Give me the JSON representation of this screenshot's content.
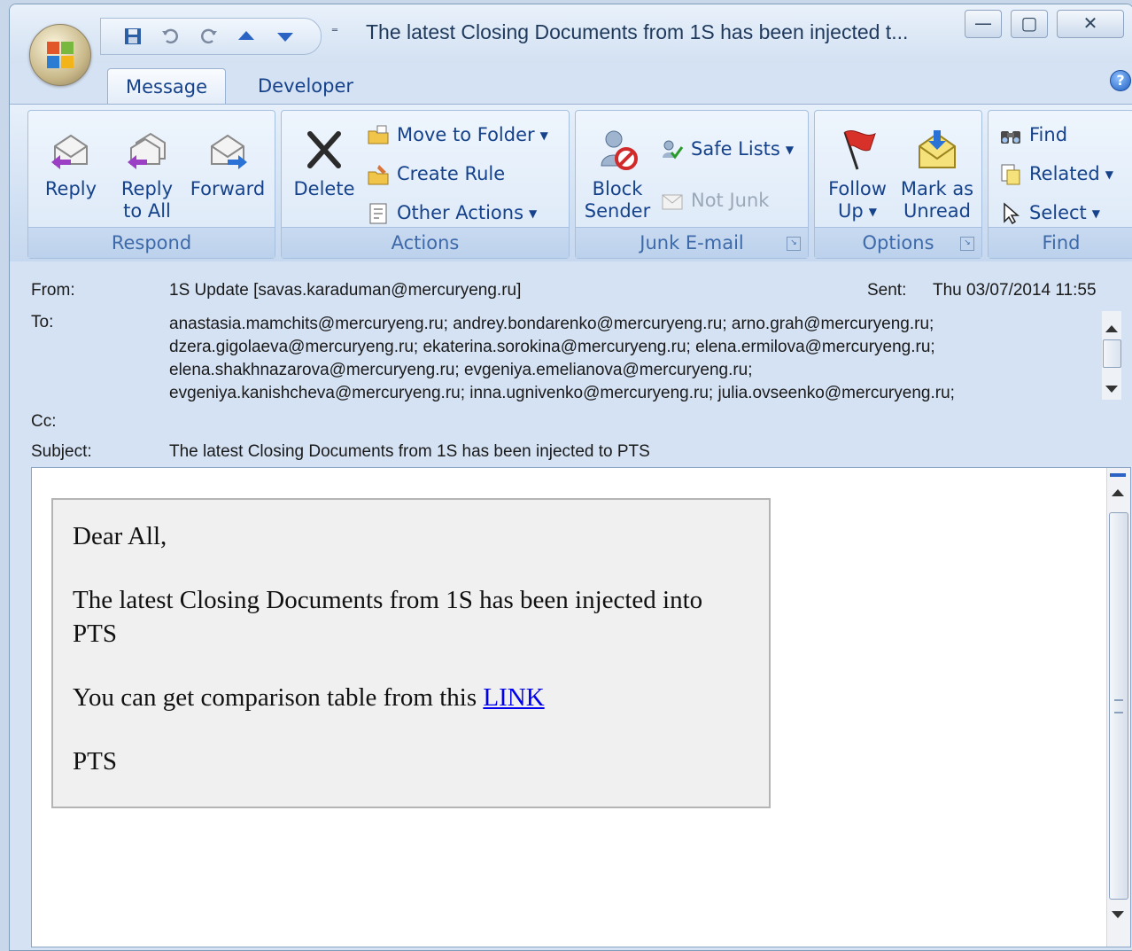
{
  "window": {
    "title": "The latest Closing Documents from 1S has been injected t...",
    "controls": {
      "minimize": "—",
      "maximize": "▢",
      "close": "✕"
    }
  },
  "qat": {
    "more": "⁼"
  },
  "tabs": [
    {
      "label": "Message",
      "active": true
    },
    {
      "label": "Developer",
      "active": false
    }
  ],
  "help": {
    "glyph": "?"
  },
  "ribbon": {
    "respond": {
      "label": "Respond",
      "reply": "Reply",
      "reply_all_1": "Reply",
      "reply_all_2": "to All",
      "forward": "Forward"
    },
    "actions": {
      "label": "Actions",
      "delete": "Delete",
      "move_to_folder": "Move to Folder",
      "create_rule": "Create Rule",
      "other_actions": "Other Actions"
    },
    "junk": {
      "label": "Junk E-mail",
      "block_1": "Block",
      "block_2": "Sender",
      "safe_lists": "Safe Lists",
      "not_junk": "Not Junk"
    },
    "options": {
      "label": "Options",
      "follow_1": "Follow",
      "follow_2": "Up",
      "mark_1": "Mark as",
      "mark_2": "Unread"
    },
    "find": {
      "label": "Find",
      "find": "Find",
      "related": "Related",
      "select": "Select"
    }
  },
  "header": {
    "from_label": "From:",
    "from_value": "1S Update [savas.karaduman@mercuryeng.ru]",
    "sent_label": "Sent:",
    "sent_value": "Thu 03/07/2014 11:55",
    "to_label": "To:",
    "to_lines": [
      "anastasia.mamchits@mercuryeng.ru; andrey.bondarenko@mercuryeng.ru; arno.grah@mercuryeng.ru;",
      "dzera.gigolaeva@mercuryeng.ru; ekaterina.sorokina@mercuryeng.ru; elena.ermilova@mercuryeng.ru;",
      "elena.shakhnazarova@mercuryeng.ru; evgeniya.emelianova@mercuryeng.ru;",
      "evgeniya.kanishcheva@mercuryeng.ru; inna.ugnivenko@mercuryeng.ru; julia.ovseenko@mercuryeng.ru;"
    ],
    "cc_label": "Cc:",
    "subject_label": "Subject:",
    "subject_value": "The latest Closing Documents from 1S has been injected to PTS"
  },
  "body": {
    "greeting": "Dear All,",
    "line1": "The latest Closing Documents from 1S has been injected into PTS",
    "line2_prefix": "You can get comparison table from this ",
    "link": "LINK",
    "signature": "PTS"
  }
}
